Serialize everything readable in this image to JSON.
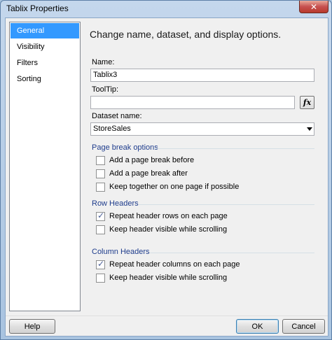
{
  "window": {
    "title": "Tablix Properties",
    "close_glyph": "✕"
  },
  "nav": {
    "items": [
      "General",
      "Visibility",
      "Filters",
      "Sorting"
    ],
    "selected": "General"
  },
  "general": {
    "heading": "Change name, dataset, and display options.",
    "name_label": "Name:",
    "name_value": "Tablix3",
    "tooltip_label": "ToolTip:",
    "tooltip_value": "",
    "fx_label": "fx",
    "dataset_label": "Dataset name:",
    "dataset_value": "StoreSales"
  },
  "page_break": {
    "title": "Page break options",
    "options": [
      {
        "label": "Add a page break before",
        "checked": false
      },
      {
        "label": "Add a page break after",
        "checked": false
      },
      {
        "label": "Keep together on one page if possible",
        "checked": false
      }
    ]
  },
  "row_headers": {
    "title": "Row Headers",
    "options": [
      {
        "label": "Repeat header rows on each page",
        "checked": true
      },
      {
        "label": "Keep header visible while scrolling",
        "checked": false
      }
    ]
  },
  "column_headers": {
    "title": "Column Headers",
    "options": [
      {
        "label": "Repeat header columns on each page",
        "checked": true
      },
      {
        "label": "Keep header visible while scrolling",
        "checked": false
      }
    ]
  },
  "footer": {
    "help_label": "Help",
    "ok_label": "OK",
    "cancel_label": "Cancel"
  }
}
